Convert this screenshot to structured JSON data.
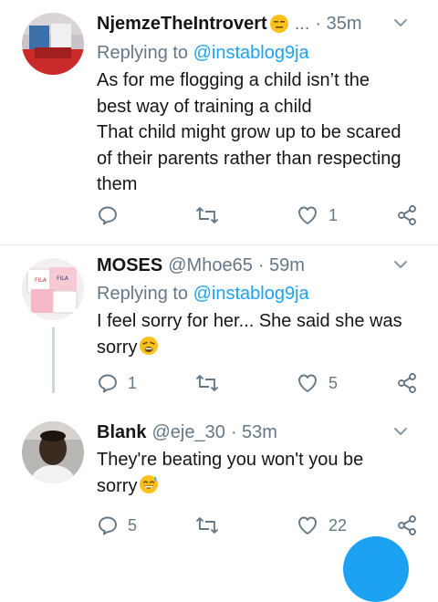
{
  "tweets": [
    {
      "name": "NjemzeTheIntrovert",
      "handle": "",
      "ellipsis": "...",
      "time": "· 35m",
      "replying_prefix": "Replying to",
      "replying_to": "@instablog9ja",
      "lines": [
        "As for me flogging a child isn’t the",
        "best way of training a child",
        "That child might grow up to be scared",
        "of their parents rather than respecting",
        "them"
      ],
      "reply_count": "",
      "retweet_count": "",
      "like_count": "1"
    },
    {
      "name": "MOSES",
      "handle": "@Mhoe65",
      "time": "· 59m",
      "replying_prefix": "Replying to",
      "replying_to": "@instablog9ja",
      "lines": [
        "I feel sorry for her... She said she was",
        "sorry"
      ],
      "reply_count": "1",
      "retweet_count": "",
      "like_count": "5"
    },
    {
      "name": "Blank",
      "handle": "@eje_30",
      "time": "· 53m",
      "lines": [
        "They're beating you won't you be",
        "sorry"
      ],
      "reply_count": "5",
      "retweet_count": "",
      "like_count": "22"
    }
  ],
  "colors": {
    "accent": "#1da1f2",
    "secondary_text": "#657786",
    "thread_line": "#ccd6dd"
  },
  "icons": [
    "reply-icon",
    "retweet-icon",
    "like-icon",
    "share-icon",
    "chevron-down-icon",
    "expressionless-emoji-icon",
    "weary-emoji-icon",
    "sweat-smile-emoji-icon"
  ]
}
